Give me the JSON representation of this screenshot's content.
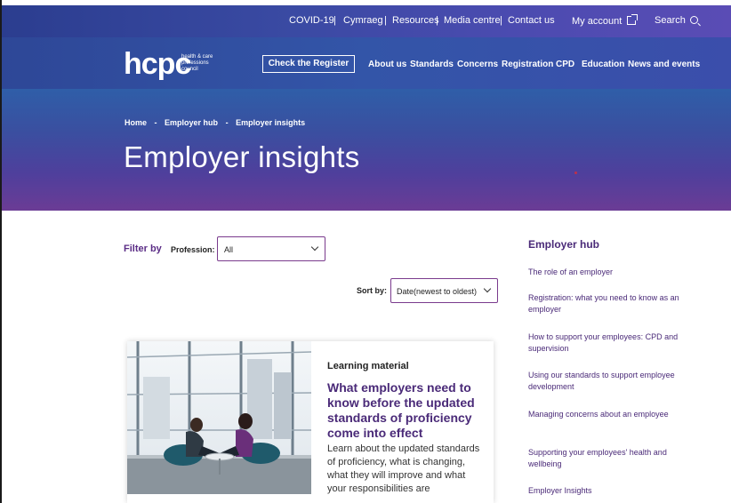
{
  "utility": {
    "covid": "COVID-19",
    "cymraeg": "Cymraeg",
    "resources": "Resources",
    "media": "Media centre",
    "contact": "Contact us",
    "account": "My account",
    "search": "Search"
  },
  "nav": {
    "logo_word": "hcpc",
    "logo_sub_1": "health & care",
    "logo_sub_2": "professions",
    "logo_sub_3": "council",
    "check_register": "Check the Register",
    "about": "About us",
    "standards": "Standards",
    "concerns": "Concerns",
    "registration": "Registration",
    "cpd": "CPD",
    "education": "Education",
    "news": "News and events"
  },
  "hero": {
    "crumb_home": "Home",
    "crumb_sep": "-",
    "crumb_hub": "Employer hub",
    "crumb_current": "Employer insights",
    "title": "Employer insights"
  },
  "filter": {
    "label": "Filter by",
    "profession_label": "Profession:",
    "profession_value": "All",
    "sort_label": "Sort by:",
    "sort_value": "Date(newest to oldest)"
  },
  "card": {
    "type": "Learning material",
    "title": "What employers need to know before the updated standards of proficiency come into effect",
    "desc": "Learn about the updated standards of proficiency, what is changing, what they will improve and what your responsibilities are"
  },
  "sidebar": {
    "title": "Employer hub",
    "links": [
      "The role of an employer",
      "Registration: what you need to know as an employer",
      "How to support your employees: CPD and supervision",
      "Using our standards to support employee development",
      "Managing concerns about an employee",
      "Supporting your employees' health and wellbeing",
      "Employer Insights"
    ]
  },
  "colors": {
    "brand_purple": "#4a2a78",
    "nav_blue": "#3355a8",
    "hero_bottom": "#6b3c95"
  }
}
